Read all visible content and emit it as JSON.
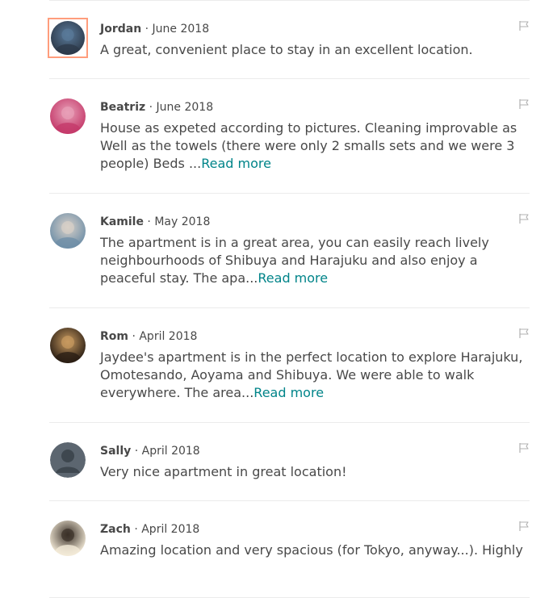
{
  "reviews": [
    {
      "name": "Jordan",
      "separator": " · ",
      "date": "June 2018",
      "text": "A great, convenient place to stay in an excellent location.",
      "read_more": "",
      "avatar_icon": "avatar-photo-icon",
      "avatar_colors": [
        "#2d3a4a",
        "#5a7a9a"
      ],
      "selected": true
    },
    {
      "name": "Beatriz",
      "separator": " · ",
      "date": "June 2018",
      "text": "House as expeted according to pictures. Cleaning improvable as Well as the towels (there were only 2 smalls sets and we were 3 people) Beds ...",
      "read_more": "Read more",
      "avatar_icon": "avatar-photo-icon",
      "avatar_colors": [
        "#c43a6a",
        "#e8a0b8"
      ]
    },
    {
      "name": "Kamile",
      "separator": " · ",
      "date": "May 2018",
      "text": "The apartment is in a great area, you can easily reach lively neighbourhoods of Shibuya and Harajuku and also enjoy a peaceful stay. The apa...",
      "read_more": "Read more",
      "avatar_icon": "avatar-photo-icon",
      "avatar_colors": [
        "#6f8fa8",
        "#d8d0c8"
      ]
    },
    {
      "name": "Rom",
      "separator": " · ",
      "date": "April 2018",
      "text": "Jaydee's apartment is in the perfect location to explore Harajuku, Omotesando, Aoyama and Shibuya. We were able to walk everywhere. The area...",
      "read_more": "Read more",
      "avatar_icon": "avatar-photo-icon",
      "avatar_colors": [
        "#2a1e14",
        "#c89a60"
      ]
    },
    {
      "name": "Sally",
      "separator": " · ",
      "date": "April 2018",
      "text": "Very nice apartment in great location!",
      "read_more": "",
      "avatar_icon": "default-avatar-icon",
      "avatar_colors": [
        "#5c6670",
        "#3e474f"
      ]
    },
    {
      "name": "Zach",
      "separator": " · ",
      "date": "April 2018",
      "text": "Amazing location and very spacious (for Tokyo, anyway...). Highly",
      "read_more": "",
      "avatar_icon": "avatar-photo-icon",
      "avatar_colors": [
        "#f4ebd8",
        "#3a3028"
      ]
    }
  ],
  "colors": {
    "link": "#008489",
    "text": "#484848",
    "divider": "#ebebeb",
    "selection": "#ff9d7c"
  }
}
